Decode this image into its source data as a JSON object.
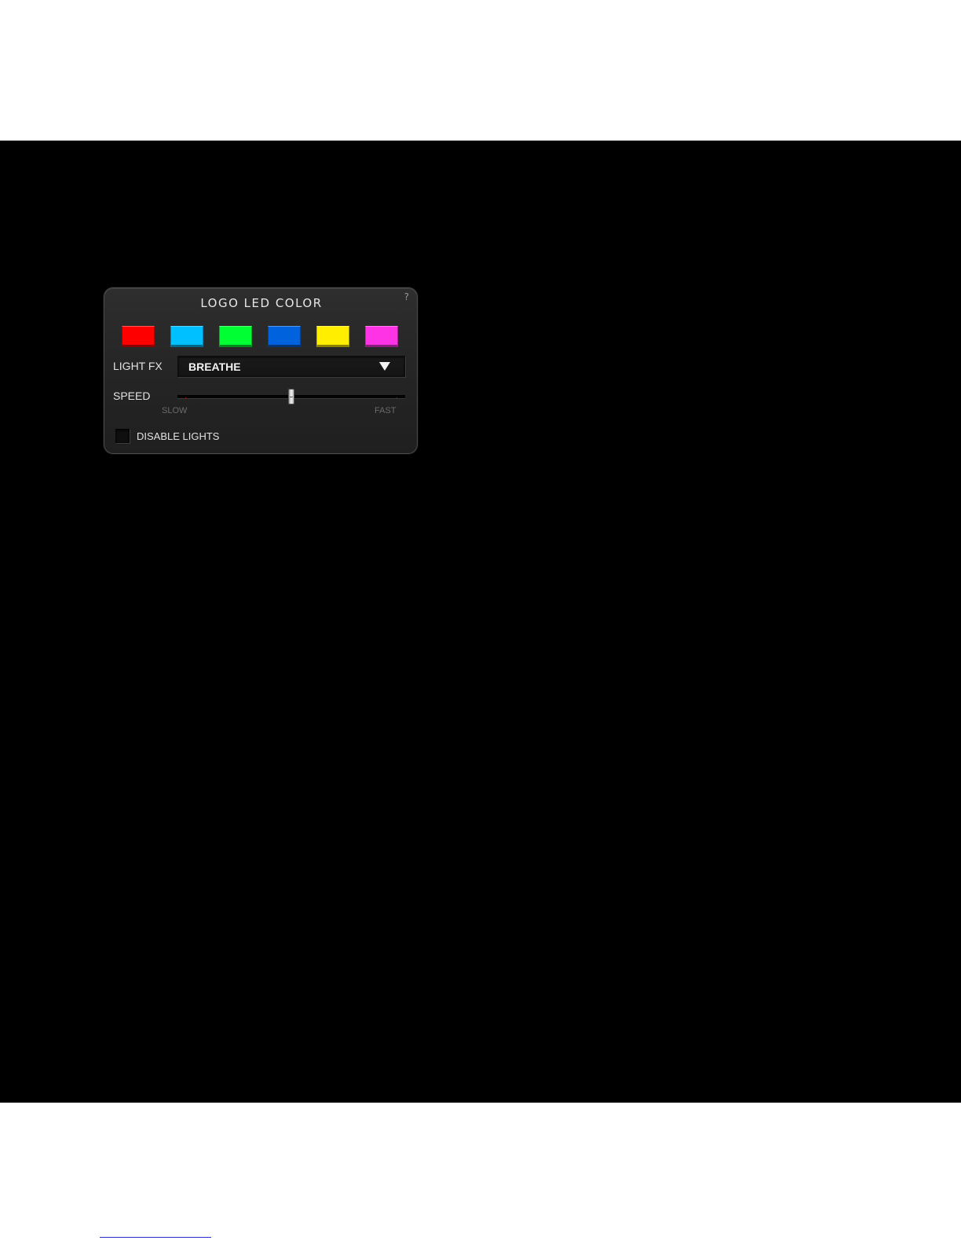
{
  "panel": {
    "title": "LOGO LED COLOR",
    "help_label": "?"
  },
  "swatches": [
    {
      "name": "red",
      "color": "#ff0000"
    },
    {
      "name": "cyan",
      "color": "#00c0ff"
    },
    {
      "name": "green",
      "color": "#00ff33"
    },
    {
      "name": "blue",
      "color": "#0062dd"
    },
    {
      "name": "yellow",
      "color": "#ffee00"
    },
    {
      "name": "magenta",
      "color": "#ff33e6"
    }
  ],
  "light_fx": {
    "label": "LIGHT FX",
    "value": "BREATHE",
    "arrow_icon": "triangle-down-icon"
  },
  "speed": {
    "label": "SPEED",
    "min_label": "SLOW",
    "max_label": "FAST",
    "level": 0.5
  },
  "disable_lights": {
    "label": "DISABLE LIGHTS",
    "checked": false
  }
}
